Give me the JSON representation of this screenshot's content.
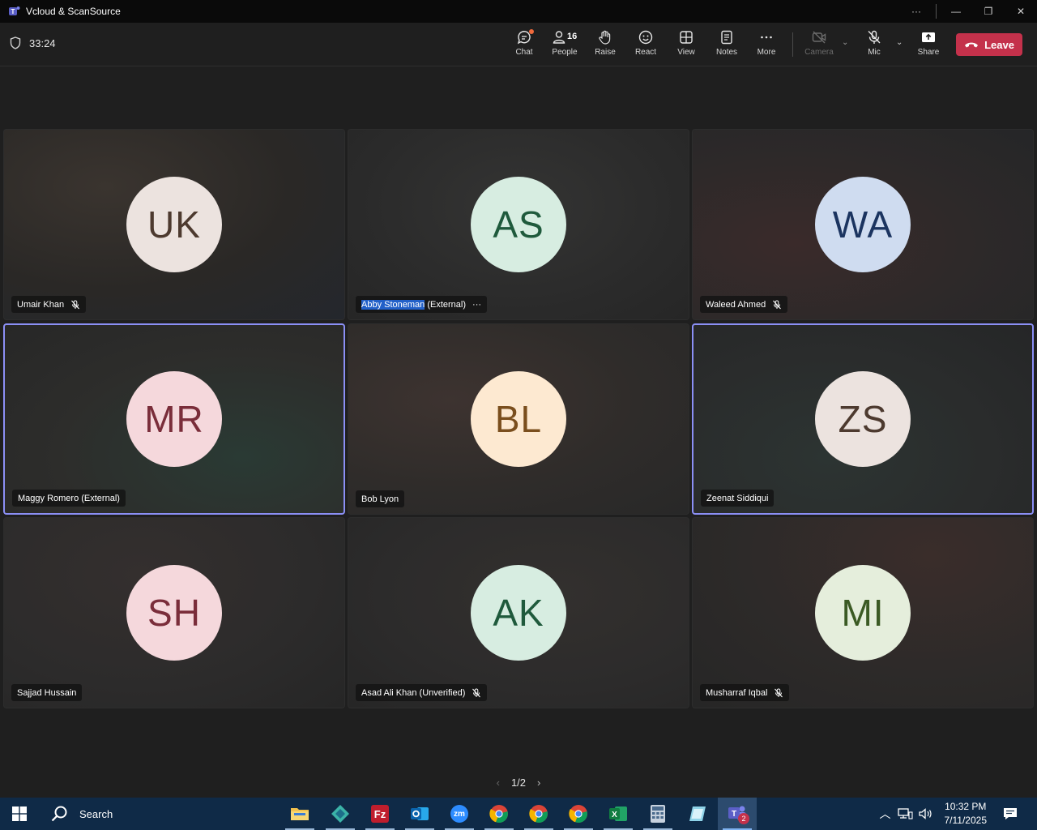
{
  "window": {
    "title": "Vcloud & ScanSource",
    "more": "···",
    "minimize": "—",
    "restore": "❐",
    "close": "✕"
  },
  "meeting": {
    "timer": "33:24",
    "toolbar": {
      "chat": "Chat",
      "people": "People",
      "people_count": "16",
      "raise": "Raise",
      "react": "React",
      "view": "View",
      "notes": "Notes",
      "more": "More",
      "camera": "Camera",
      "mic": "Mic",
      "share": "Share",
      "leave": "Leave"
    }
  },
  "participants": [
    {
      "initials": "UK",
      "name": "Umair Khan",
      "muted": true,
      "bg": "#ece3df",
      "fg": "#4d3a2f"
    },
    {
      "initials": "AS",
      "name": "Abby Stoneman",
      "suffix": " (External)",
      "muted": false,
      "more": "···",
      "bg": "#d7ede1",
      "fg": "#1f5a3c"
    },
    {
      "initials": "WA",
      "name": "Waleed Ahmed",
      "muted": true,
      "bg": "#cfdcf0",
      "fg": "#1b3460"
    },
    {
      "initials": "MR",
      "name": "Maggy Romero (External)",
      "muted": false,
      "bg": "#f5d8dc",
      "fg": "#7a2d3a"
    },
    {
      "initials": "BL",
      "name": "Bob Lyon",
      "muted": false,
      "bg": "#fde9d1",
      "fg": "#7a4e1d"
    },
    {
      "initials": "ZS",
      "name": "Zeenat Siddiqui",
      "muted": false,
      "bg": "#ece3df",
      "fg": "#4d3a2f"
    },
    {
      "initials": "SH",
      "name": "Sajjad Hussain",
      "muted": false,
      "bg": "#f5d8dc",
      "fg": "#7a2d3a"
    },
    {
      "initials": "AK",
      "name": "Asad Ali Khan (Unverified)",
      "muted": true,
      "bg": "#d7ede1",
      "fg": "#1f5a3c"
    },
    {
      "initials": "MI",
      "name": "Musharraf Iqbal",
      "muted": true,
      "bg": "#e5eedc",
      "fg": "#3b5a24"
    }
  ],
  "pager": {
    "label": "1/2"
  },
  "taskbar": {
    "search": "Search",
    "time": "10:32 PM",
    "date": "7/11/2025",
    "teams_badge": "2",
    "zoom_label": "zm"
  }
}
